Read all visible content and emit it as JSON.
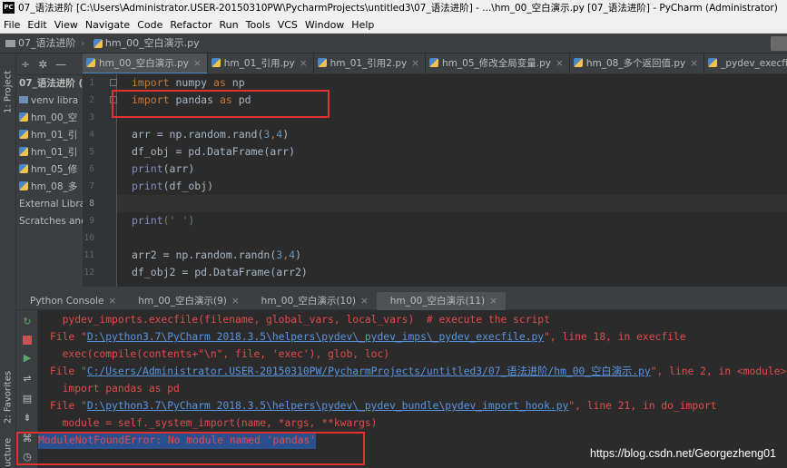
{
  "title_bar": {
    "app_icon": "PC",
    "text": "07_语法进阶 [C:\\Users\\Administrator.USER-20150310PW\\PycharmProjects\\untitled3\\07_语法进阶] - ...\\hm_00_空白演示.py [07_语法进阶] - PyCharm (Administrator)"
  },
  "menu": [
    "File",
    "Edit",
    "View",
    "Navigate",
    "Code",
    "Refactor",
    "Run",
    "Tools",
    "VCS",
    "Window",
    "Help"
  ],
  "breadcrumb": {
    "project": "07_语法进阶",
    "file": "hm_00_空白演示.py"
  },
  "left_stripe": {
    "project_label": "1: Project",
    "favorites_label": "2: Favorites",
    "structure_label": "ucture"
  },
  "project_panel": {
    "root": "07_语法进阶 (",
    "items": [
      "venv libra",
      "hm_00_空",
      "hm_01_引",
      "hm_01_引",
      "hm_05_修",
      "hm_08_多",
      "External Libra",
      "Scratches and"
    ]
  },
  "editor_tabs": [
    {
      "label": "hm_00_空白演示.py",
      "active": true
    },
    {
      "label": "hm_01_引用.py",
      "active": false
    },
    {
      "label": "hm_01_引用2.py",
      "active": false
    },
    {
      "label": "hm_05_修改全局变量.py",
      "active": false
    },
    {
      "label": "hm_08_多个返回值.py",
      "active": false
    },
    {
      "label": "_pydev_execfile.py",
      "active": false
    }
  ],
  "line_numbers": [
    "1",
    "2",
    "3",
    "4",
    "5",
    "6",
    "7",
    "8",
    "9",
    "10",
    "11",
    "12"
  ],
  "code": {
    "l1_kw": "import",
    "l1_rest": " numpy ",
    "l1_as": "as",
    "l1_alias": " np",
    "l2_kw": "import",
    "l2_rest": " pandas ",
    "l2_as": "as",
    "l2_alias": " pd",
    "l4_a": "arr = np.random.rand(",
    "l4_n1": "3",
    "l4_c": ",",
    "l4_n2": "4",
    "l4_b": ")",
    "l5": "df_obj = pd.DataFrame(arr)",
    "l6_fn": "print",
    "l6_rest": "(arr)",
    "l7_fn": "print",
    "l7_rest": "(df_obj)",
    "l9_fn": "print",
    "l9_rest": "(' ')",
    "l11_a": "arr2 = np.random.randn(",
    "l11_n1": "3",
    "l11_c": ",",
    "l11_n2": "4",
    "l11_b": ")",
    "l12": "df_obj2 = pd.DataFrame(arr2)"
  },
  "console_tabs": [
    {
      "label": "Python Console",
      "active": false
    },
    {
      "label": "hm_00_空白演示(9)",
      "active": false
    },
    {
      "label": "hm_00_空白演示(10)",
      "active": false
    },
    {
      "label": "hm_00_空白演示(11)",
      "active": true
    }
  ],
  "console": {
    "line1": "  pydev_imports.execfile(filename, global_vars, local_vars)  # execute the script",
    "line2_pre": "File \"",
    "line2_link": "D:\\python3.7\\PyCharm 2018.3.5\\helpers\\pydev\\_pydev_imps\\_pydev_execfile.py",
    "line2_post": "\", line 18, in execfile",
    "line3": "  exec(compile(contents+\"\\n\", file, 'exec'), glob, loc)",
    "line4_pre": "File \"",
    "line4_link": "C:/Users/Administrator.USER-20150310PW/PycharmProjects/untitled3/07_语法进阶/hm_00_空白演示.py",
    "line4_post": "\", line 2, in <module>",
    "line5": "  import pandas as pd",
    "line6_pre": "File \"",
    "line6_link": "D:\\python3.7\\PyCharm 2018.3.5\\helpers\\pydev\\_pydev_bundle\\pydev_import_hook.py",
    "line6_post": "\", line 21, in do_import",
    "line7": "  module = self._system_import(name, *args, **kwargs)",
    "error": "ModuleNotFoundError: No module named 'pandas'"
  },
  "watermark": "https://blog.csdn.net/Georgezheng01",
  "colors": {
    "highlight_box": "#e03030",
    "error_text": "#e14b4b",
    "link": "#5894e0",
    "keyword": "#cc7832",
    "number": "#6897bb"
  }
}
